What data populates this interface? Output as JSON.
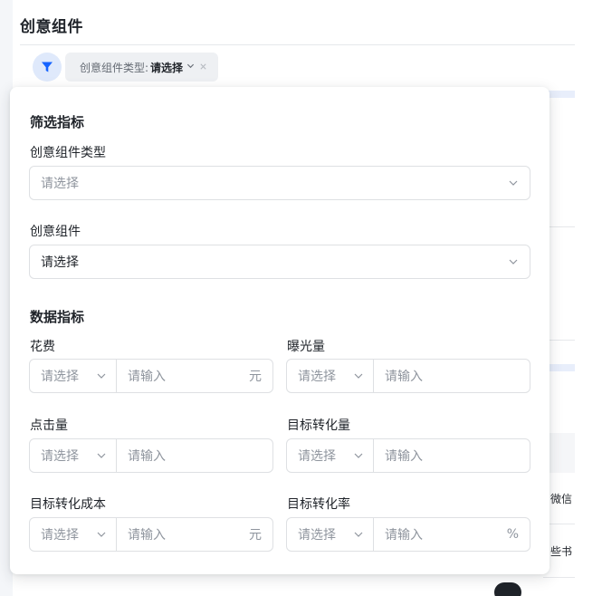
{
  "page": {
    "title": "创意组件"
  },
  "filter_chip": {
    "label": "创意组件类型:",
    "value": "请选择",
    "chevron_icon": "chevron-down-icon",
    "close_icon": "close-icon"
  },
  "filter_icon": "funnel-icon",
  "background_text": {
    "row1": "微信",
    "row2": "些书"
  },
  "popover": {
    "filter_section_title": "筛选指标",
    "creative_type": {
      "label": "创意组件类型",
      "placeholder": "请选择"
    },
    "creative": {
      "label": "创意组件",
      "value": "请选择"
    },
    "data_section_title": "数据指标",
    "metrics": [
      {
        "label": "花费",
        "op_placeholder": "请选择",
        "input_placeholder": "请输入",
        "unit": "元"
      },
      {
        "label": "曝光量",
        "op_placeholder": "请选择",
        "input_placeholder": "请输入",
        "unit": ""
      },
      {
        "label": "点击量",
        "op_placeholder": "请选择",
        "input_placeholder": "请输入",
        "unit": ""
      },
      {
        "label": "目标转化量",
        "op_placeholder": "请选择",
        "input_placeholder": "请输入",
        "unit": ""
      },
      {
        "label": "目标转化成本",
        "op_placeholder": "请选择",
        "input_placeholder": "请输入",
        "unit": "元"
      },
      {
        "label": "目标转化率",
        "op_placeholder": "请选择",
        "input_placeholder": "请输入",
        "unit": "%"
      }
    ]
  },
  "colors": {
    "accent": "#1664ff",
    "accent_soft": "#dfe9fb",
    "border": "#dee0e3",
    "placeholder": "#8f959e",
    "text": "#1f2329"
  }
}
